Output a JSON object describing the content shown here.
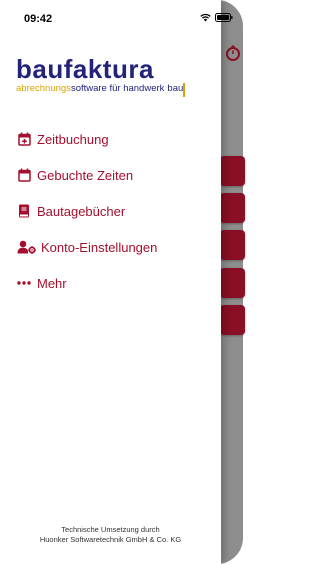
{
  "status_bar": {
    "time": "09:42"
  },
  "logo": {
    "word": "baufaktura",
    "tagline_part1": "abrechnungs",
    "tagline_part2": "software für handwerk",
    "tagline_part3": "bau"
  },
  "menu": {
    "items": [
      {
        "label": "Zeitbuchung",
        "icon": "calendar-plus-icon"
      },
      {
        "label": "Gebuchte Zeiten",
        "icon": "calendar-icon"
      },
      {
        "label": "Bautagebücher",
        "icon": "book-icon"
      },
      {
        "label": "Konto-Einstellungen",
        "icon": "user-cog-icon"
      },
      {
        "label": "Mehr",
        "icon": "ellipsis-icon"
      }
    ]
  },
  "footer": {
    "line1": "Technische Umsetzung durch",
    "line2": "Huonker Softwaretechnik GmbH & Co. KG"
  },
  "colors": {
    "accent": "#a50f2d",
    "brand_blue": "#23237a",
    "brand_gold": "#d9a400",
    "backdrop": "#8e8e8e",
    "tile": "#8a0f24"
  }
}
